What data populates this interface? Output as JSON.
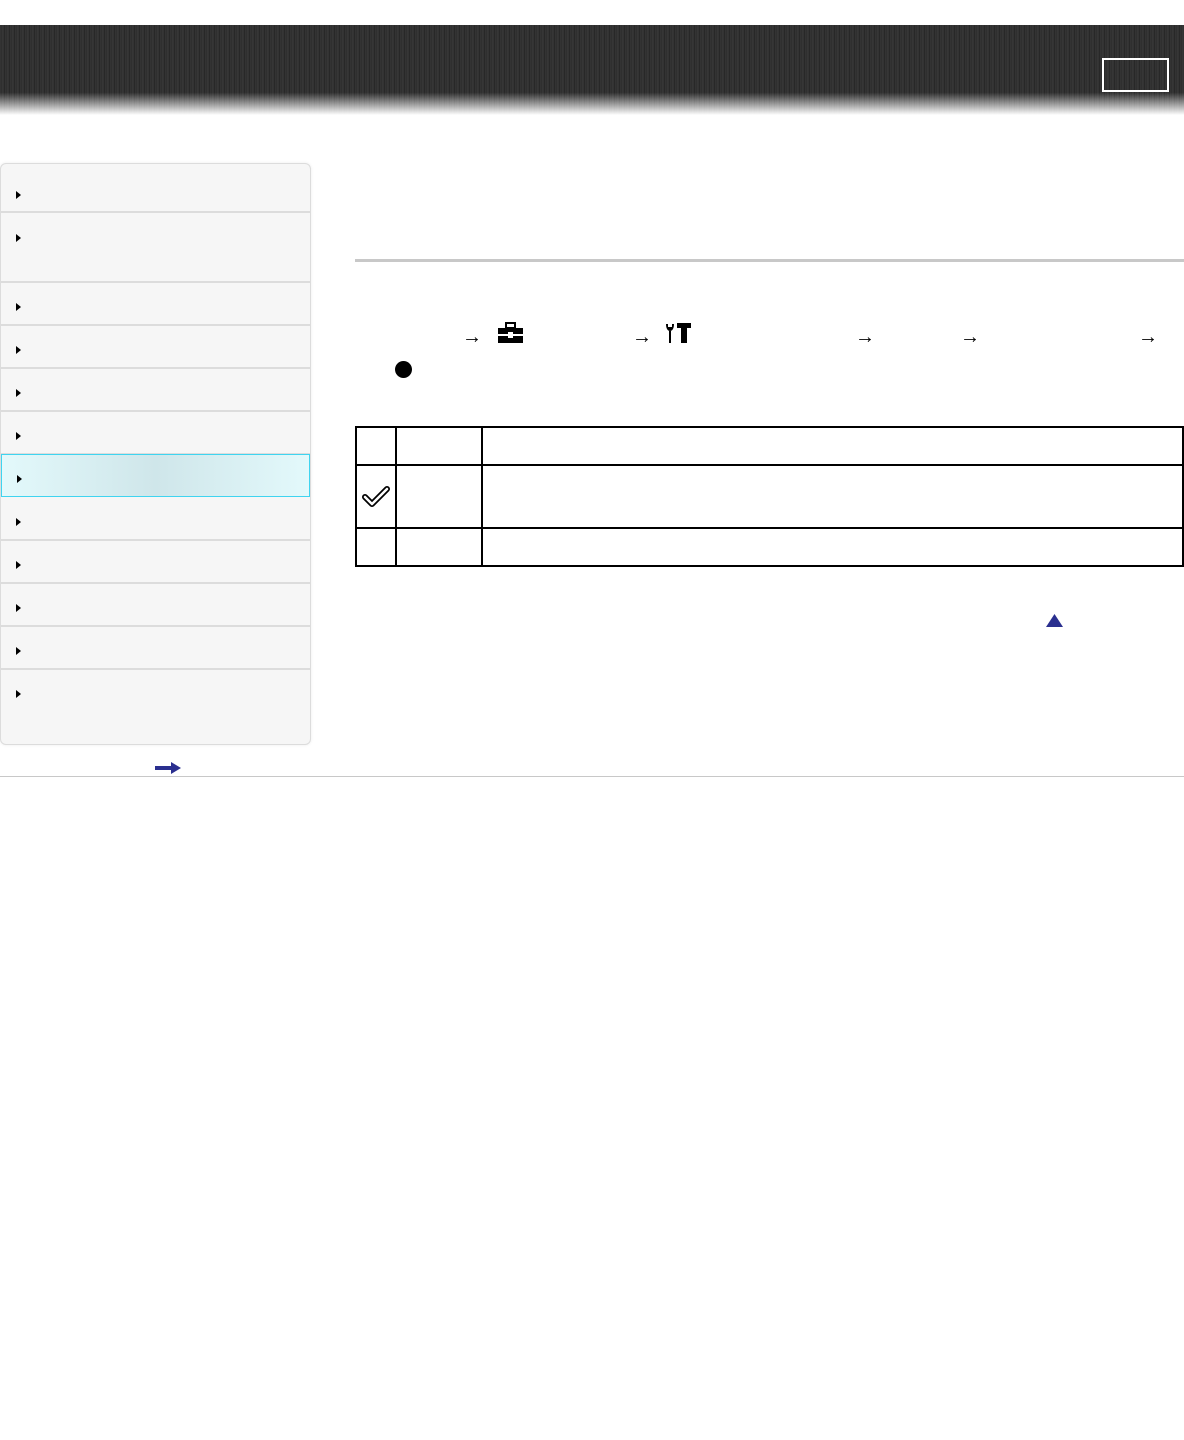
{
  "header": {
    "title": "",
    "top_button_label": ""
  },
  "sidebar": {
    "items": [
      {
        "label": ""
      },
      {
        "label": ""
      },
      {
        "label": ""
      },
      {
        "label": ""
      },
      {
        "label": ""
      },
      {
        "label": ""
      },
      {
        "label": "",
        "active": true
      },
      {
        "label": ""
      },
      {
        "label": ""
      },
      {
        "label": ""
      },
      {
        "label": ""
      },
      {
        "label": ""
      }
    ],
    "more_link_icon": "right-arrow-icon"
  },
  "main": {
    "title": "",
    "path": {
      "separator": "→",
      "icons": [
        "toolbox-icon",
        "setup-tools-icon"
      ],
      "steps": [
        "",
        "",
        "",
        "",
        ""
      ]
    },
    "options_table": {
      "rows": [
        {
          "icon": "",
          "name": "",
          "description": ""
        },
        {
          "icon": "check-icon",
          "name": "",
          "description": ""
        },
        {
          "icon": "",
          "name": "",
          "description": ""
        }
      ]
    },
    "back_to_top_icon": "up-triangle-icon"
  },
  "colors": {
    "header_bg": "#2b2b2b",
    "sidebar_bg": "#f6f6f6",
    "active_border": "#3fd4f0",
    "active_bg": "#e3f9fb",
    "link_blue": "#2a2f8f"
  }
}
